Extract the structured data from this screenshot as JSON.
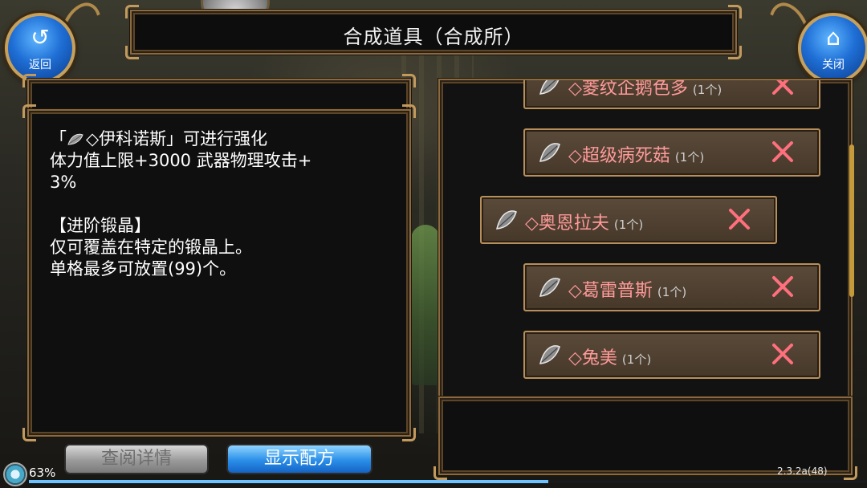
{
  "header": {
    "title": "合成道具（合成所）",
    "back_label": "返回",
    "close_label": "关闭",
    "back_icon": "↺",
    "close_icon": "⌂"
  },
  "description": {
    "lines_1": "「",
    "item_name": "◇伊科诺斯」可进行强化",
    "body": "体力值上限+3000 武器物理攻击+\n3%\n\n【进阶锻晶】\n仅可覆盖在特定的锻晶上。\n单格最多可放置(99)个。"
  },
  "materials": [
    {
      "name": "◇菱纹企鹅色多",
      "qty": "(1个)"
    },
    {
      "name": "◇超级病死菇",
      "qty": "(1个)"
    },
    {
      "name": "◇奥恩拉夫",
      "qty": "(1个)"
    },
    {
      "name": "◇葛雷普斯",
      "qty": "(1个)"
    },
    {
      "name": "◇兔美",
      "qty": "(1个)"
    }
  ],
  "buttons": {
    "detail": "查阅详情",
    "recipe": "显示配方"
  },
  "status": {
    "battery": "63%",
    "version": "2.3.2a(48)"
  },
  "colors": {
    "frame": "#8a6a3e",
    "item_name": "#ff9a9a",
    "remove": "#ff6f7d",
    "blue_button": "#2a8ee8"
  }
}
